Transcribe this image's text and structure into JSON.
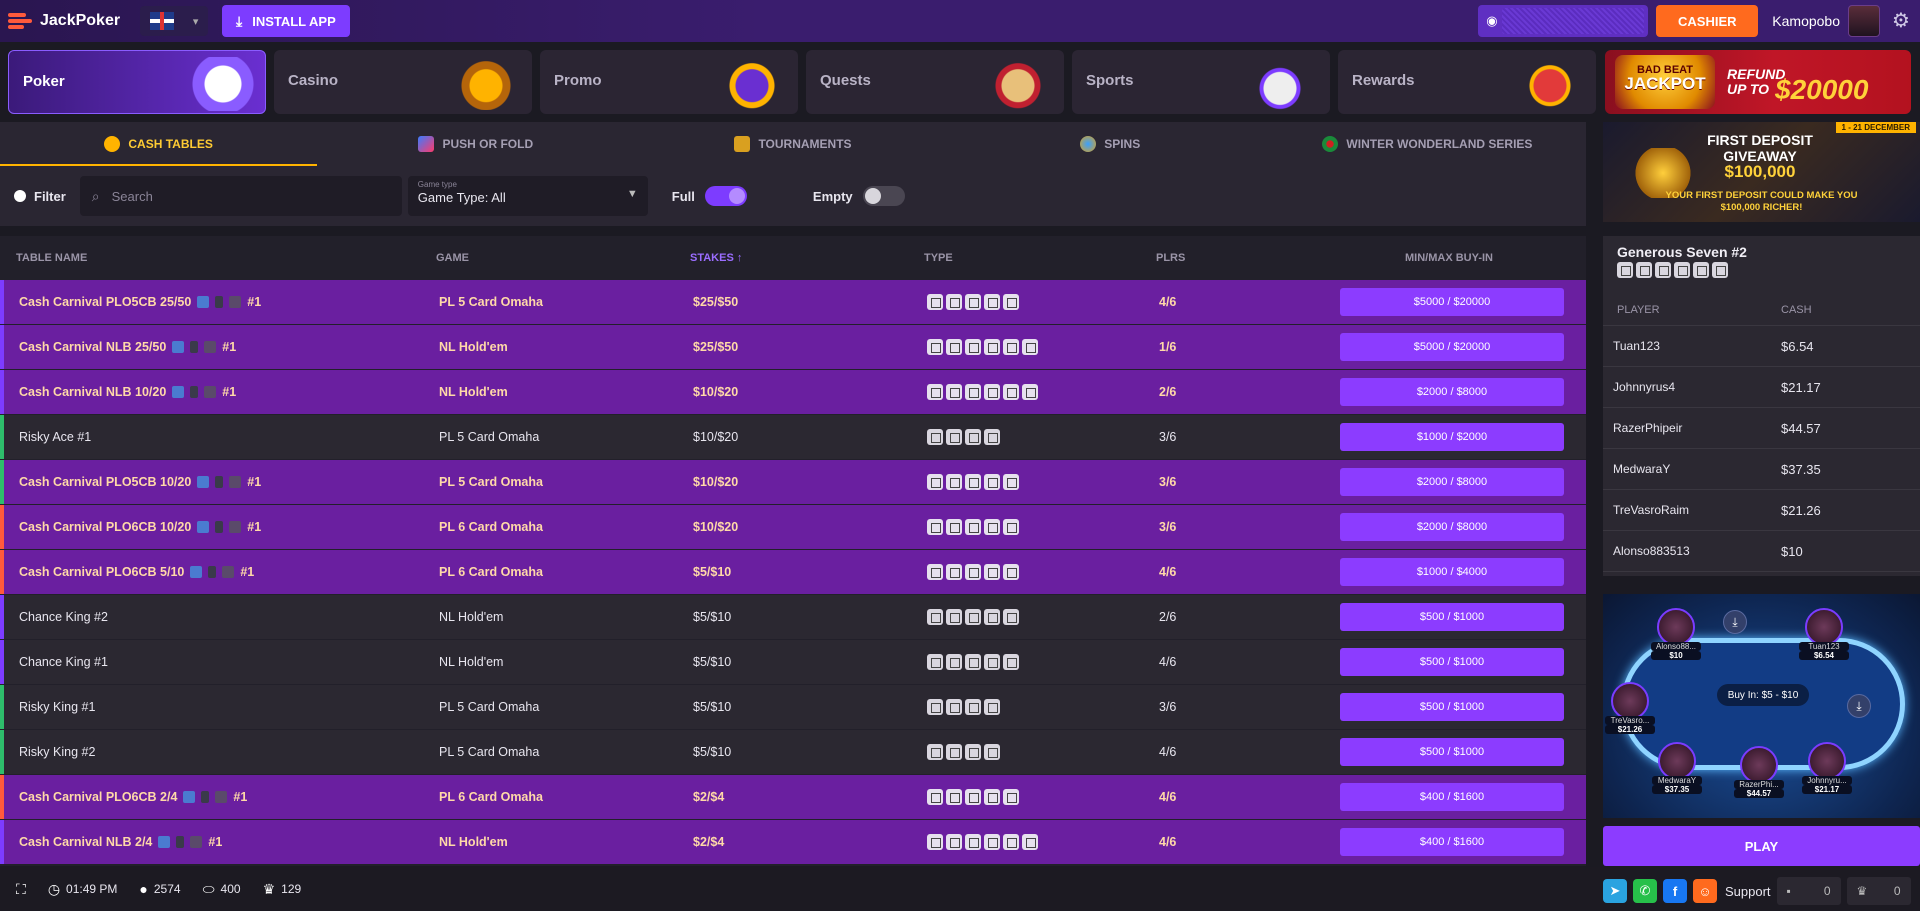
{
  "app": {
    "brand": "JackPoker",
    "install_label": "INSTALL APP",
    "cashier_label": "CASHIER",
    "username": "Kamopobo"
  },
  "categories": [
    {
      "label": "Poker",
      "active": true
    },
    {
      "label": "Casino",
      "active": false
    },
    {
      "label": "Promo",
      "active": false
    },
    {
      "label": "Quests",
      "active": false
    },
    {
      "label": "Sports",
      "active": false
    },
    {
      "label": "Rewards",
      "active": false
    }
  ],
  "jackpot": {
    "line1": "BAD BEAT",
    "line2": "JACKPOT",
    "refund": "REFUND",
    "upto": "UP TO",
    "amount": "$20000"
  },
  "tabs": [
    {
      "label": "CASH TABLES",
      "active": true
    },
    {
      "label": "PUSH OR FOLD",
      "active": false
    },
    {
      "label": "TOURNAMENTS",
      "active": false
    },
    {
      "label": "SPINS",
      "active": false
    },
    {
      "label": "WINTER WONDERLAND SERIES",
      "active": false
    }
  ],
  "filters": {
    "filter_label": "Filter",
    "search_placeholder": "Search",
    "game_type_caption": "Game type",
    "game_type_value": "Game Type: All",
    "full_label": "Full",
    "empty_label": "Empty"
  },
  "table_headers": {
    "name": "TABLE NAME",
    "game": "GAME",
    "stakes": "STAKES ↑",
    "type": "TYPE",
    "players": "PLRS",
    "buyin": "MIN/MAX BUY-IN"
  },
  "rows": [
    {
      "name": "Cash Carnival PLO5CB 25/50",
      "suffix": "#1",
      "game": "PL 5 Card Omaha",
      "stakes": "$25/$50",
      "plrs": "4/6",
      "buyin": "$5000 / $20000",
      "promo": true,
      "bar": "#7d3cff",
      "types": 5
    },
    {
      "name": "Cash Carnival NLB 25/50",
      "suffix": "#1",
      "game": "NL Hold'em",
      "stakes": "$25/$50",
      "plrs": "1/6",
      "buyin": "$5000 / $20000",
      "promo": true,
      "bar": "#7d3cff",
      "types": 6
    },
    {
      "name": "Cash Carnival NLB 10/20",
      "suffix": "#1",
      "game": "NL Hold'em",
      "stakes": "$10/$20",
      "plrs": "2/6",
      "buyin": "$2000 / $8000",
      "promo": true,
      "bar": "#7d3cff",
      "types": 6
    },
    {
      "name": "Risky Ace #1",
      "suffix": "",
      "game": "PL 5 Card Omaha",
      "stakes": "$10/$20",
      "plrs": "3/6",
      "buyin": "$1000 / $2000",
      "promo": false,
      "bar": "#2ebd6b",
      "types": 4
    },
    {
      "name": "Cash Carnival PLO5CB 10/20",
      "suffix": "#1",
      "game": "PL 5 Card Omaha",
      "stakes": "$10/$20",
      "plrs": "3/6",
      "buyin": "$2000 / $8000",
      "promo": true,
      "bar": "#2ebd6b",
      "types": 5
    },
    {
      "name": "Cash Carnival PLO6CB 10/20",
      "suffix": "#1",
      "game": "PL 6 Card Omaha",
      "stakes": "$10/$20",
      "plrs": "3/6",
      "buyin": "$2000 / $8000",
      "promo": true,
      "bar": "#ff5a3c",
      "types": 5
    },
    {
      "name": "Cash Carnival PLO6CB 5/10",
      "suffix": "#1",
      "game": "PL 6 Card Omaha",
      "stakes": "$5/$10",
      "plrs": "4/6",
      "buyin": "$1000 / $4000",
      "promo": true,
      "bar": "#ff5a3c",
      "types": 5
    },
    {
      "name": "Chance King #2",
      "suffix": "",
      "game": "NL Hold'em",
      "stakes": "$5/$10",
      "plrs": "2/6",
      "buyin": "$500 / $1000",
      "promo": false,
      "bar": "#7d3cff",
      "types": 5
    },
    {
      "name": "Chance King #1",
      "suffix": "",
      "game": "NL Hold'em",
      "stakes": "$5/$10",
      "plrs": "4/6",
      "buyin": "$500 / $1000",
      "promo": false,
      "bar": "#7d3cff",
      "types": 5
    },
    {
      "name": "Risky King #1",
      "suffix": "",
      "game": "PL 5 Card Omaha",
      "stakes": "$5/$10",
      "plrs": "3/6",
      "buyin": "$500 / $1000",
      "promo": false,
      "bar": "#2ebd6b",
      "types": 4
    },
    {
      "name": "Risky King #2",
      "suffix": "",
      "game": "PL 5 Card Omaha",
      "stakes": "$5/$10",
      "plrs": "4/6",
      "buyin": "$500 / $1000",
      "promo": false,
      "bar": "#2ebd6b",
      "types": 4
    },
    {
      "name": "Cash Carnival PLO6CB 2/4",
      "suffix": "#1",
      "game": "PL 6 Card Omaha",
      "stakes": "$2/$4",
      "plrs": "4/6",
      "buyin": "$400 / $1600",
      "promo": true,
      "bar": "#ff5a3c",
      "types": 5
    },
    {
      "name": "Cash Carnival NLB 2/4",
      "suffix": "#1",
      "game": "NL Hold'em",
      "stakes": "$2/$4",
      "plrs": "4/6",
      "buyin": "$400 / $1600",
      "promo": true,
      "bar": "#7d3cff",
      "types": 6
    }
  ],
  "promo_banner": {
    "title1": "FIRST DEPOSIT",
    "title2": "GIVEAWAY",
    "amount": "$100,000",
    "line1": "YOUR FIRST DEPOSIT COULD MAKE YOU",
    "line2": "$100,000 RICHER!",
    "date": "1 - 21 DECEMBER"
  },
  "selected_table": {
    "title": "Generous Seven #2",
    "col_player": "PLAYER",
    "col_cash": "CASH",
    "players": [
      {
        "name": "Tuan123",
        "cash": "$6.54"
      },
      {
        "name": "Johnnyrus4",
        "cash": "$21.17"
      },
      {
        "name": "RazerPhipeir",
        "cash": "$44.57"
      },
      {
        "name": "MedwaraY",
        "cash": "$37.35"
      },
      {
        "name": "TreVasroRaim",
        "cash": "$21.26"
      },
      {
        "name": "Alonso883513",
        "cash": "$10"
      }
    ]
  },
  "preview": {
    "buyin": "Buy In: $5 - $10",
    "seats": [
      {
        "name": "Alonso88...",
        "amt": "$10"
      },
      {
        "name": "Tuan123",
        "amt": "$6.54"
      },
      {
        "name": "TreVasro...",
        "amt": "$21.26"
      },
      {
        "name": "MedwaraY",
        "amt": "$37.35"
      },
      {
        "name": "RazerPhi...",
        "amt": "$44.57"
      },
      {
        "name": "Johnnyru...",
        "amt": "$21.17"
      }
    ]
  },
  "play_label": "PLAY",
  "footer": {
    "time": "01:49 PM",
    "users": "2574",
    "tables": "400",
    "tournaments": "129",
    "support": "Support",
    "count1": "0",
    "count2": "0"
  }
}
